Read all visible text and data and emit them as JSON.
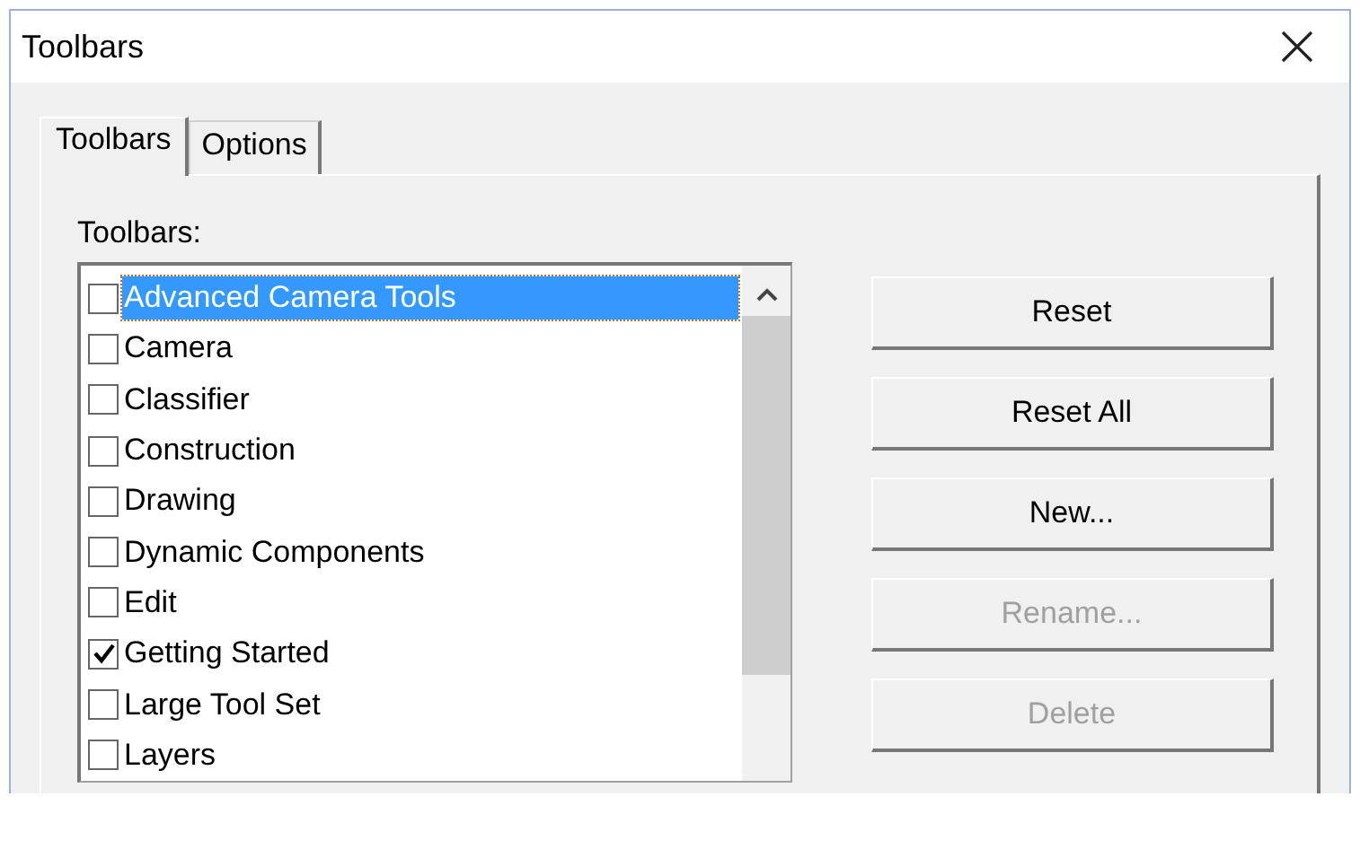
{
  "window": {
    "title": "Toolbars"
  },
  "tabs": [
    {
      "label": "Toolbars",
      "selected": true
    },
    {
      "label": "Options",
      "selected": false
    }
  ],
  "toolbars_label": "Toolbars:",
  "toolbars_list": [
    {
      "label": "Advanced Camera Tools",
      "checked": false,
      "selected": true
    },
    {
      "label": "Camera",
      "checked": false,
      "selected": false
    },
    {
      "label": "Classifier",
      "checked": false,
      "selected": false
    },
    {
      "label": "Construction",
      "checked": false,
      "selected": false
    },
    {
      "label": "Drawing",
      "checked": false,
      "selected": false
    },
    {
      "label": "Dynamic Components",
      "checked": false,
      "selected": false
    },
    {
      "label": "Edit",
      "checked": false,
      "selected": false
    },
    {
      "label": "Getting Started",
      "checked": true,
      "selected": false
    },
    {
      "label": "Large Tool Set",
      "checked": false,
      "selected": false
    },
    {
      "label": "Layers",
      "checked": false,
      "selected": false
    }
  ],
  "buttons": [
    {
      "label": "Reset",
      "disabled": false
    },
    {
      "label": "Reset All",
      "disabled": false
    },
    {
      "label": "New...",
      "disabled": false
    },
    {
      "label": "Rename...",
      "disabled": true
    },
    {
      "label": "Delete",
      "disabled": true
    }
  ]
}
